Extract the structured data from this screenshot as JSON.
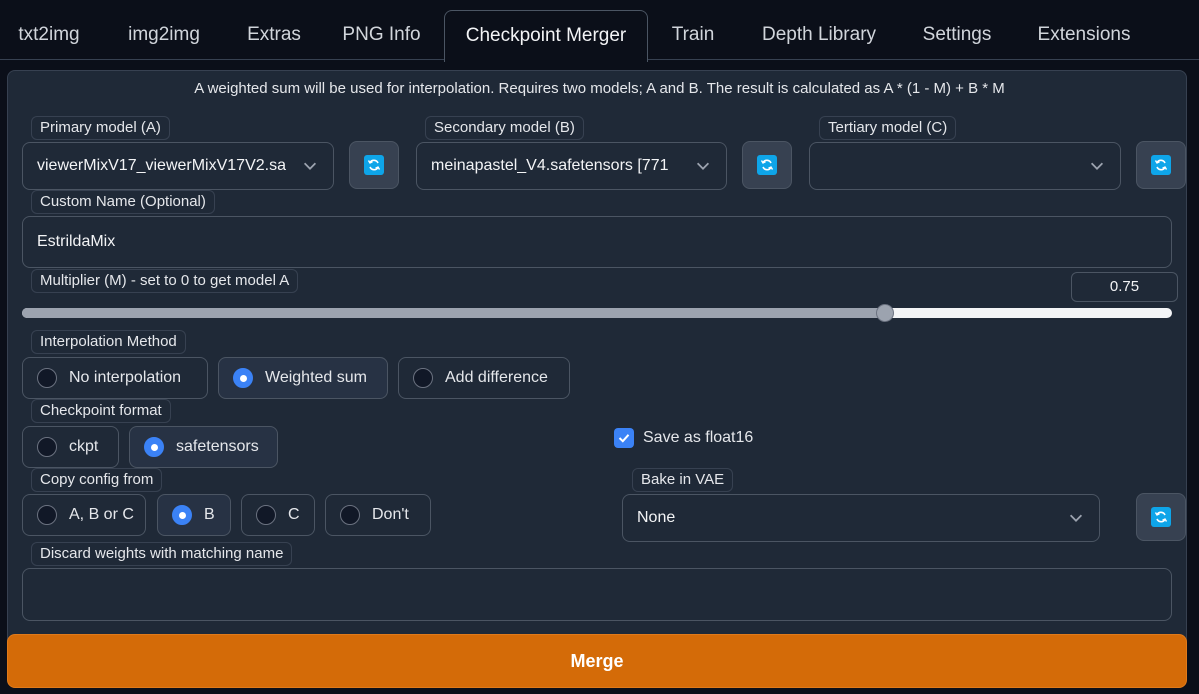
{
  "tabs": [
    {
      "label": "txt2img"
    },
    {
      "label": "img2img"
    },
    {
      "label": "Extras"
    },
    {
      "label": "PNG Info"
    },
    {
      "label": "Checkpoint Merger",
      "active": true
    },
    {
      "label": "Train"
    },
    {
      "label": "Depth Library"
    },
    {
      "label": "Settings"
    },
    {
      "label": "Extensions"
    }
  ],
  "info_text": "A weighted sum will be used for interpolation. Requires two models; A and B. The result is calculated as A * (1 - M) + B * M",
  "primary_model": {
    "label": "Primary model (A)",
    "value": "viewerMixV17_viewerMixV17V2.sa"
  },
  "secondary_model": {
    "label": "Secondary model (B)",
    "value": "meinapastel_V4.safetensors [771"
  },
  "tertiary_model": {
    "label": "Tertiary model (C)",
    "value": ""
  },
  "custom_name": {
    "label": "Custom Name (Optional)",
    "value": "EstrildaMix"
  },
  "multiplier": {
    "label": "Multiplier (M) - set to 0 to get model A",
    "value": "0.75",
    "min": 0,
    "max": 1,
    "fraction": 0.75
  },
  "interpolation": {
    "label": "Interpolation Method",
    "options": [
      {
        "label": "No interpolation",
        "selected": false
      },
      {
        "label": "Weighted sum",
        "selected": true
      },
      {
        "label": "Add difference",
        "selected": false
      }
    ]
  },
  "checkpoint_format": {
    "label": "Checkpoint format",
    "options": [
      {
        "label": "ckpt",
        "selected": false
      },
      {
        "label": "safetensors",
        "selected": true
      }
    ]
  },
  "save_float16": {
    "label": "Save as float16",
    "checked": true
  },
  "copy_config": {
    "label": "Copy config from",
    "options": [
      {
        "label": "A, B or C",
        "selected": false
      },
      {
        "label": "B",
        "selected": true
      },
      {
        "label": "C",
        "selected": false
      },
      {
        "label": "Don't",
        "selected": false
      }
    ]
  },
  "bake_vae": {
    "label": "Bake in VAE",
    "value": "None"
  },
  "discard_weights": {
    "label": "Discard weights with matching name",
    "value": ""
  },
  "merge_button": {
    "label": "Merge"
  },
  "colors": {
    "accent": "#3b82f6",
    "merge": "#d46b08",
    "refresh": "#0ea5e9"
  },
  "icons": {
    "refresh": "refresh-icon",
    "dropdown": "chevron-down-icon",
    "check": "check-icon"
  }
}
